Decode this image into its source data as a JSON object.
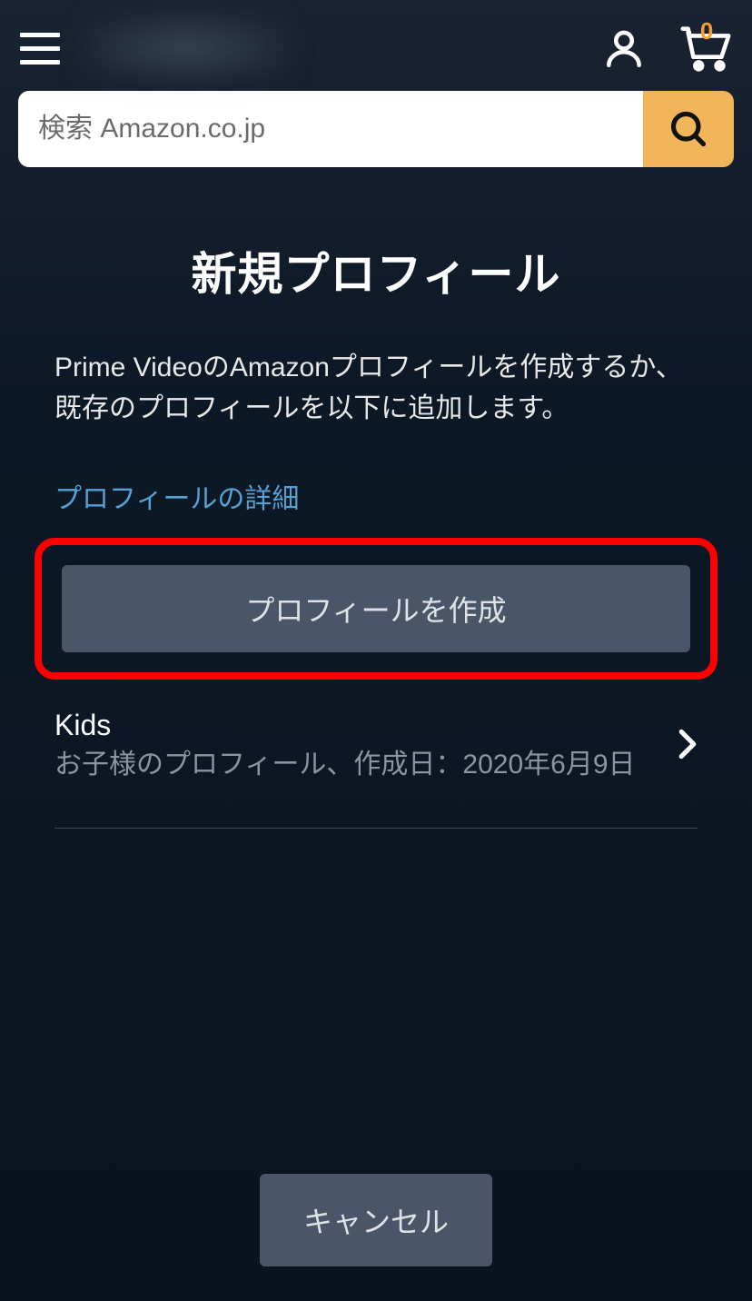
{
  "header": {
    "cart_count": "0"
  },
  "search": {
    "placeholder": "検索 Amazon.co.jp"
  },
  "page": {
    "title": "新規プロフィール",
    "description": "Prime VideoのAmazonプロフィールを作成するか、既存のプロフィールを以下に追加します。",
    "details_link": "プロフィールの詳細",
    "create_button": "プロフィールを作成",
    "cancel_button": "キャンセル"
  },
  "profiles": [
    {
      "name": "Kids",
      "description": "お子様のプロフィール、作成日：2020年6月9日"
    }
  ]
}
